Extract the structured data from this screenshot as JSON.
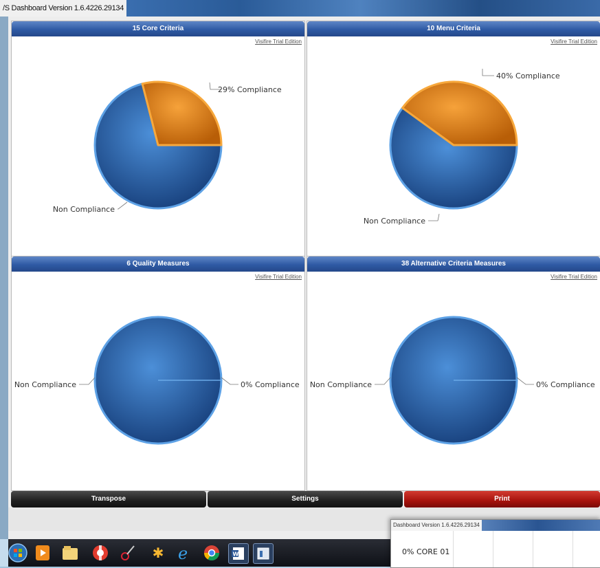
{
  "window": {
    "title": "/S Dashboard Version 1.6.4226.29134"
  },
  "trial_text": "Visifire Trial Edition",
  "chart_data": [
    {
      "type": "pie",
      "title": "15 Core Criteria",
      "slices": [
        {
          "label": "29% Compliance",
          "value": 29,
          "color": "#f0891c"
        },
        {
          "label": "Non Compliance",
          "value": 71,
          "color": "#2f6db8"
        }
      ]
    },
    {
      "type": "pie",
      "title": "10 Menu Criteria",
      "slices": [
        {
          "label": "40% Compliance",
          "value": 40,
          "color": "#f0891c"
        },
        {
          "label": "Non Compliance",
          "value": 60,
          "color": "#2f6db8"
        }
      ]
    },
    {
      "type": "pie",
      "title": "6 Quality Measures",
      "slices": [
        {
          "label": "0% Compliance",
          "value": 0,
          "color": "#f0891c"
        },
        {
          "label": "Non Compliance",
          "value": 100,
          "color": "#2f6db8"
        }
      ]
    },
    {
      "type": "pie",
      "title": "38 Alternative Criteria Measures",
      "slices": [
        {
          "label": "0% Compliance",
          "value": 0,
          "color": "#f0891c"
        },
        {
          "label": "Non Compliance",
          "value": 100,
          "color": "#2f6db8"
        }
      ]
    }
  ],
  "buttons": {
    "transpose": "Transpose",
    "settings": "Settings",
    "print": "Print"
  },
  "taskbar": {
    "icons": [
      "windows-start-icon",
      "media-player-icon",
      "file-explorer-icon",
      "help-lifebuoy-icon",
      "snipping-tool-icon",
      "flower-app-icon",
      "internet-explorer-icon",
      "chrome-icon",
      "word-icon",
      "dashboard-app-icon"
    ]
  },
  "mini_window": {
    "title": "Dashboard Version 1.6.4226.29134",
    "row_label": "0% CORE 01"
  },
  "colors": {
    "accent": "#2f5aa4",
    "compliance": "#f0891c",
    "non_compliance": "#2f6db8",
    "print": "#a6120c"
  }
}
